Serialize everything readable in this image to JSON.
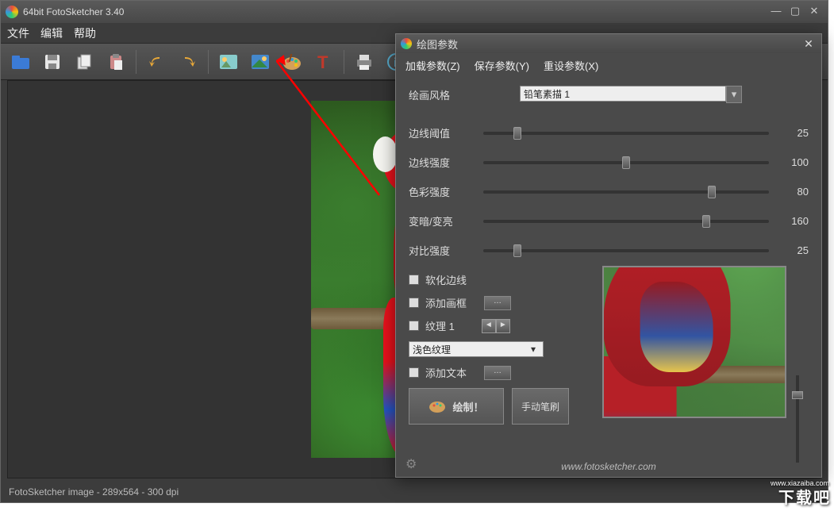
{
  "title": "64bit FotoSketcher 3.40",
  "menu": {
    "file": "文件",
    "edit": "编辑",
    "help": "帮助"
  },
  "status": "FotoSketcher image - 289x564 - 300 dpi",
  "dialog": {
    "title": "绘图参数",
    "menu": {
      "load": "加载参数(Z)",
      "save": "保存参数(Y)",
      "reset": "重设参数(X)"
    },
    "style_label": "绘画风格",
    "style_value": "铅笔素描 1",
    "sliders": [
      {
        "label": "边线阈值",
        "value": 25,
        "pct": 12
      },
      {
        "label": "边线强度",
        "value": 100,
        "pct": 50
      },
      {
        "label": "色彩强度",
        "value": 80,
        "pct": 80
      },
      {
        "label": "变暗/变亮",
        "value": 160,
        "pct": 78
      },
      {
        "label": "对比强度",
        "value": 25,
        "pct": 12
      }
    ],
    "opts": {
      "soften": "软化边线",
      "frame": "添加画框",
      "texture": "纹理 1",
      "texture_sel": "浅色纹理",
      "text": "添加文本"
    },
    "actions": {
      "draw": "绘制！",
      "brush": "手动笔刷"
    },
    "url": "www.fotosketcher.com"
  },
  "watermark": {
    "big": "下载吧",
    "url": "www.xiazaiba.com"
  }
}
